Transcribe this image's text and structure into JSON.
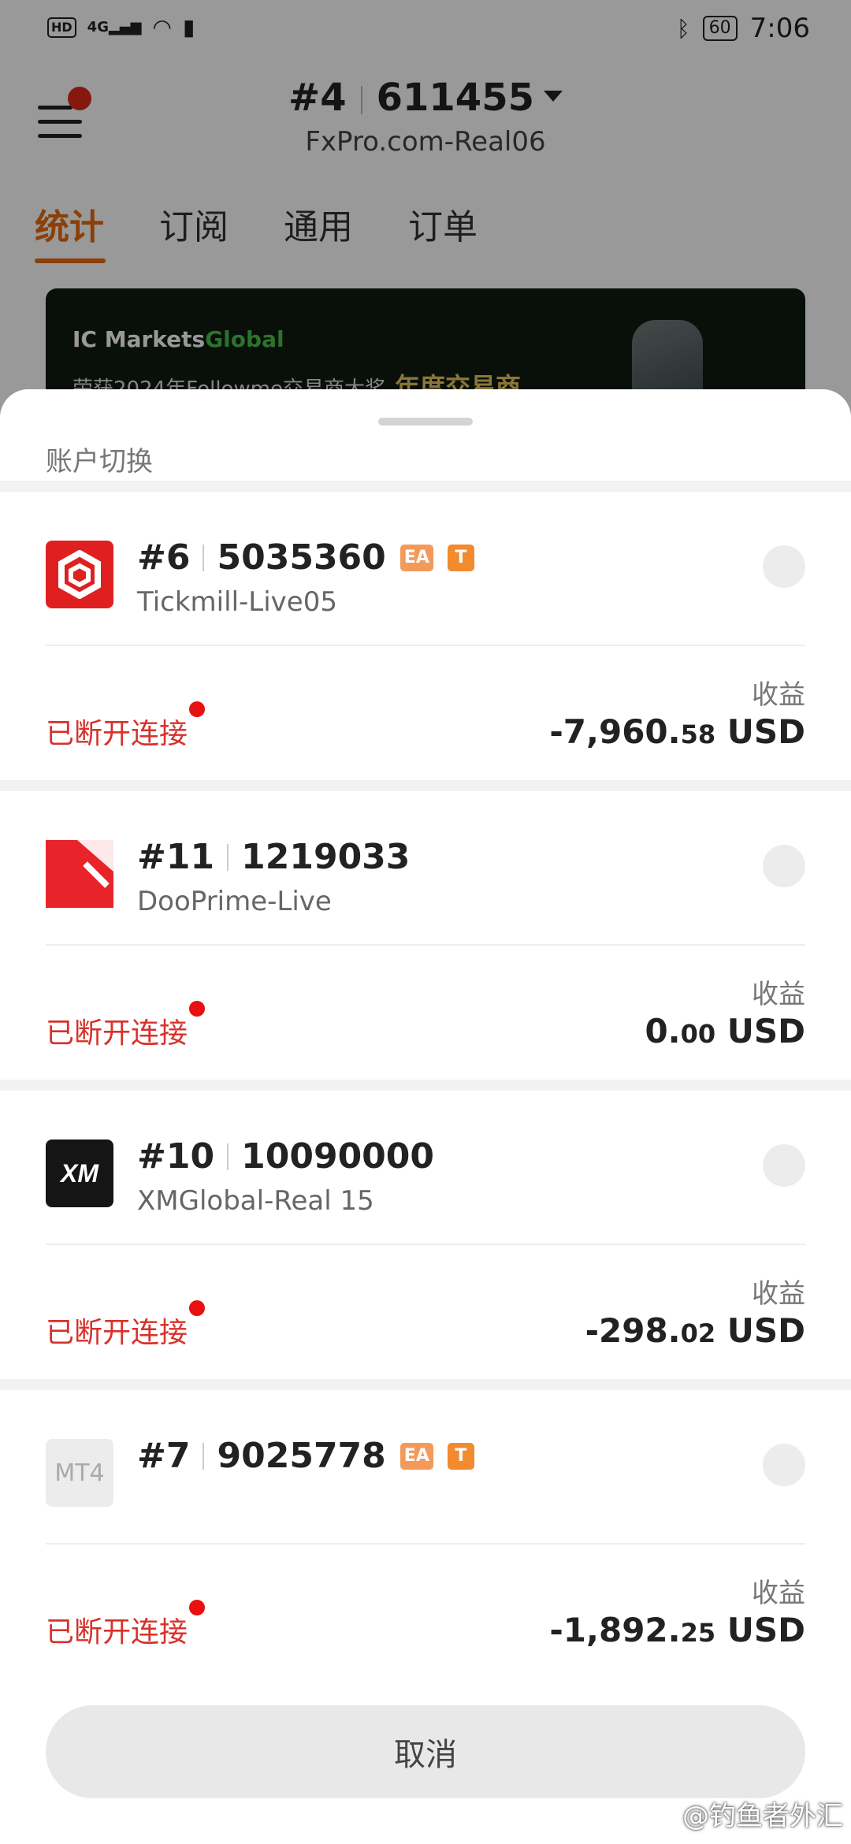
{
  "status_bar": {
    "left_indicator_hd": "HD",
    "left_indicator_net": "4G",
    "battery": "60",
    "time": "7:06"
  },
  "header": {
    "account_index": "#4",
    "account_number": "611455",
    "server": "FxPro.com-Real06"
  },
  "tabs": [
    {
      "label": "统计",
      "active": true
    },
    {
      "label": "订阅",
      "active": false
    },
    {
      "label": "通用",
      "active": false
    },
    {
      "label": "订单",
      "active": false
    }
  ],
  "banner": {
    "brand_prefix": "IC Markets",
    "brand_suffix": "Global",
    "text": "荣获2024年Followme交易商大奖",
    "highlight": "年度交易商"
  },
  "sheet": {
    "title": "账户切换",
    "cancel_label": "取消",
    "profit_label": "收益",
    "accounts": [
      {
        "index": "#6",
        "number": "5035360",
        "badges": [
          "EA",
          "T"
        ],
        "server": "Tickmill-Live05",
        "status": "已断开连接",
        "profit_int": "-7,960.",
        "profit_dec": "58",
        "currency": "USD",
        "logo": "tickmill-logo"
      },
      {
        "index": "#11",
        "number": "1219033",
        "badges": [],
        "server": "DooPrime-Live",
        "status": "已断开连接",
        "profit_int": "0.",
        "profit_dec": "00",
        "currency": "USD",
        "logo": "dooprime-logo"
      },
      {
        "index": "#10",
        "number": "10090000",
        "badges": [],
        "server": "XMGlobal-Real 15",
        "status": "已断开连接",
        "profit_int": "-298.",
        "profit_dec": "02",
        "currency": "USD",
        "logo": "xm-logo"
      },
      {
        "index": "#7",
        "number": "9025778",
        "badges": [
          "EA",
          "T"
        ],
        "server": "",
        "status": "已断开连接",
        "profit_int": "-1,892.",
        "profit_dec": "25",
        "currency": "USD",
        "logo": "mt4-logo",
        "logo_text": "MT4"
      }
    ]
  },
  "watermark": "@钓鱼者外汇",
  "colors": {
    "accent": "#e86a10",
    "status_red": "#d8312b",
    "badge_orange": "#f28a2e"
  }
}
